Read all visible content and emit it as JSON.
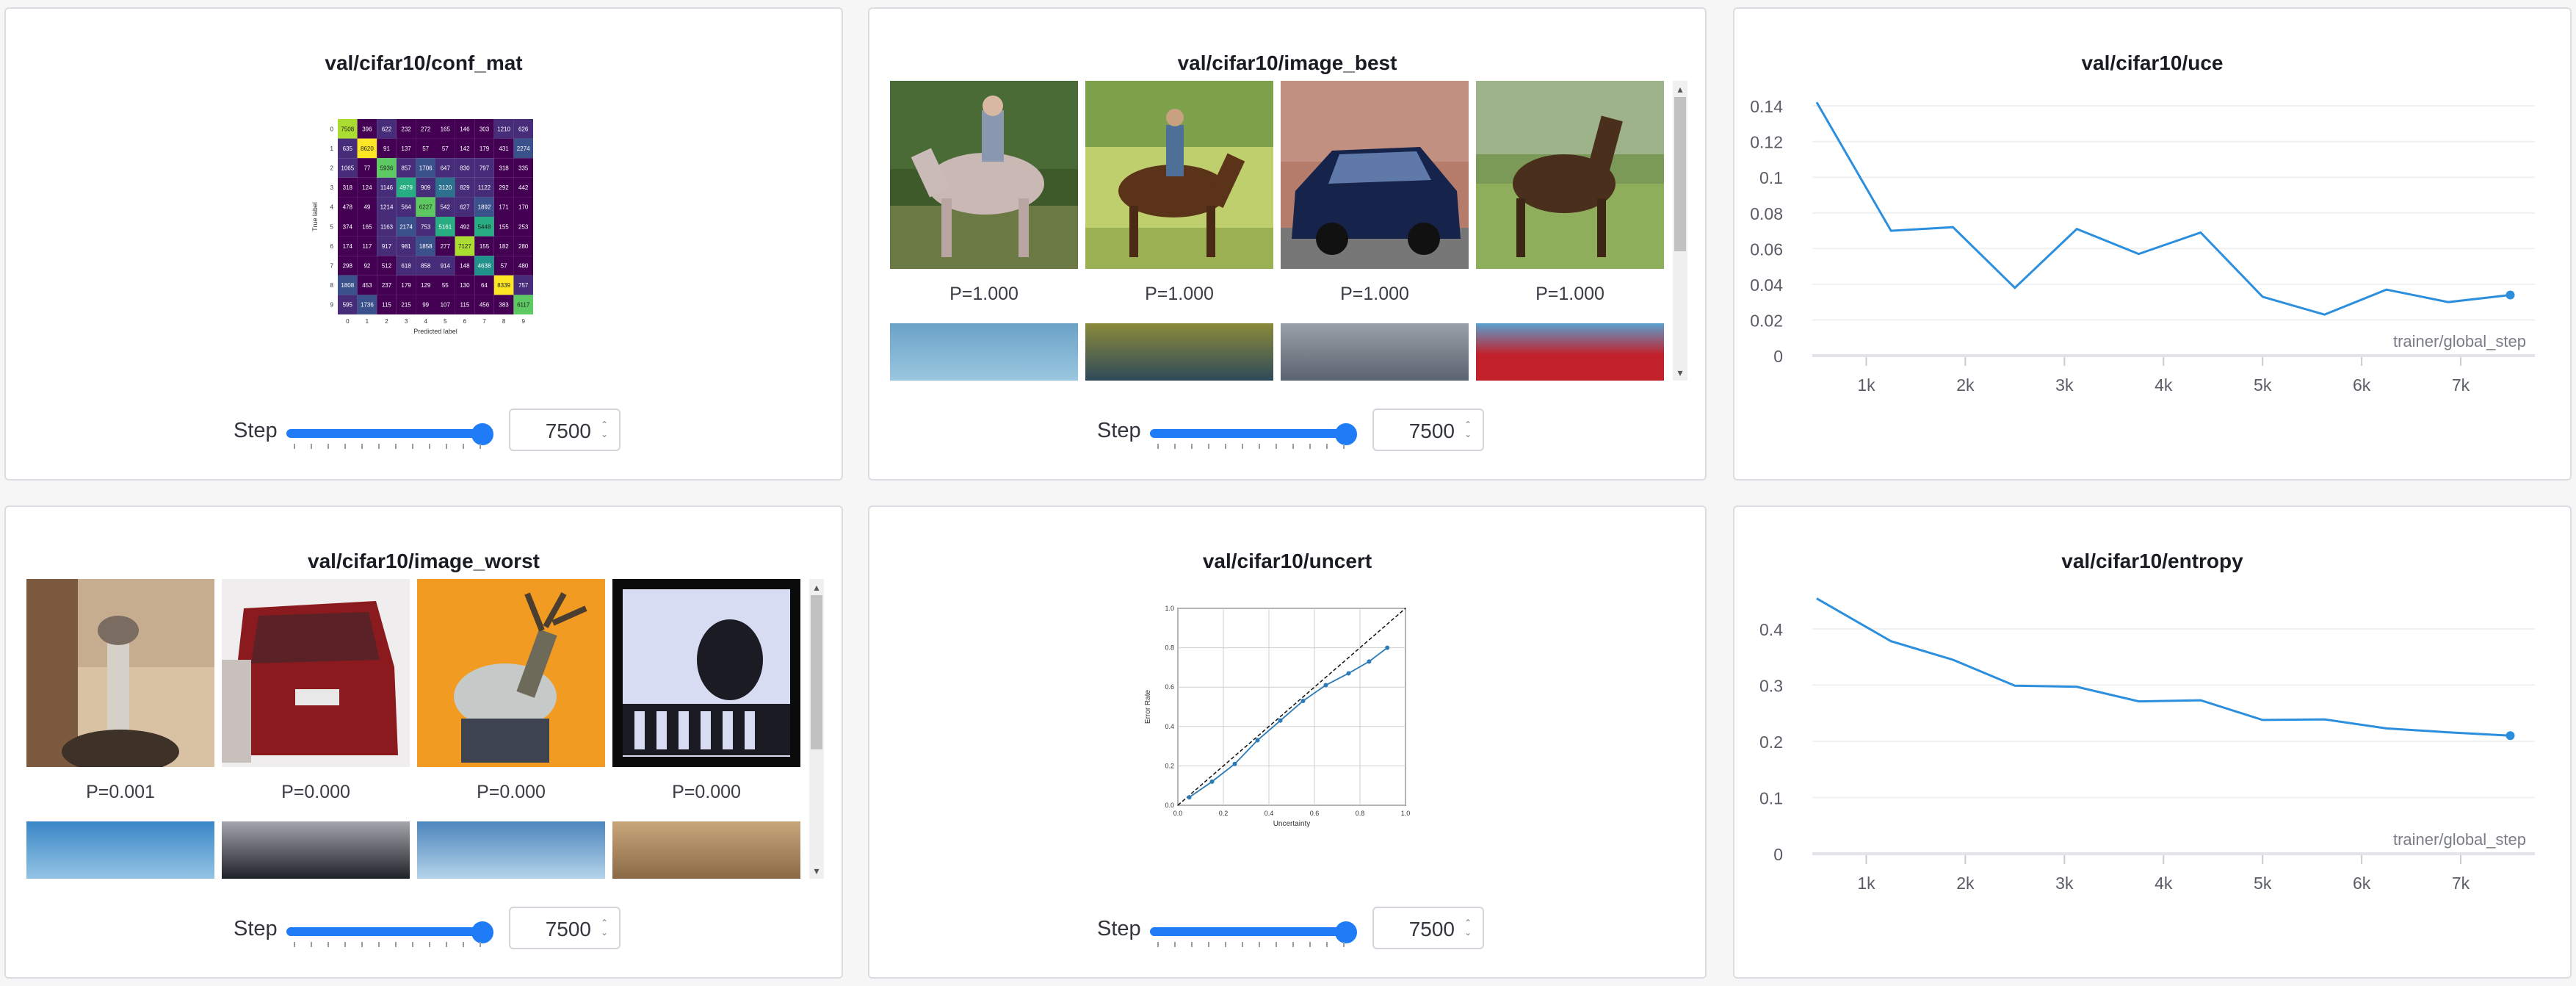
{
  "panels": {
    "conf_mat": {
      "title": "val/cifar10/conf_mat",
      "step_label": "Step",
      "step_value": "7500",
      "matrix_axes": {
        "x": "Predicted label",
        "y": "True label"
      },
      "matrix_ticks": [
        "0",
        "1",
        "2",
        "3",
        "4",
        "5",
        "6",
        "7",
        "8",
        "9"
      ],
      "matrix": [
        [
          "7508",
          "396",
          "622",
          "232",
          "272",
          "165",
          "146",
          "303",
          "1210",
          "626"
        ],
        [
          "635",
          "8620",
          "91",
          "137",
          "57",
          "57",
          "142",
          "179",
          "431",
          "2274"
        ],
        [
          "1065",
          "77",
          "5936",
          "857",
          "1706",
          "647",
          "830",
          "797",
          "318",
          "335"
        ],
        [
          "318",
          "124",
          "1146",
          "4979",
          "909",
          "3120",
          "829",
          "1122",
          "292",
          "442"
        ],
        [
          "478",
          "49",
          "1214",
          "564",
          "6227",
          "542",
          "627",
          "1892",
          "171",
          "170"
        ],
        [
          "374",
          "165",
          "1163",
          "2174",
          "753",
          "5161",
          "492",
          "5448",
          "155",
          "253"
        ],
        [
          "174",
          "117",
          "917",
          "981",
          "1858",
          "277",
          "7127",
          "155",
          "182",
          "280"
        ],
        [
          "298",
          "92",
          "512",
          "618",
          "858",
          "914",
          "148",
          "4638",
          "57",
          "480"
        ],
        [
          "1808",
          "453",
          "237",
          "179",
          "129",
          "55",
          "130",
          "64",
          "8339",
          "757"
        ],
        [
          "595",
          "1736",
          "115",
          "215",
          "99",
          "107",
          "115",
          "456",
          "383",
          "6117"
        ]
      ]
    },
    "image_best": {
      "title": "val/cifar10/image_best",
      "step_label": "Step",
      "step_value": "7500",
      "captions": [
        "P=1.000",
        "P=1.000",
        "P=1.000",
        "P=1.000"
      ]
    },
    "uce": {
      "title": "val/cifar10/uce",
      "xaxis_label": "trainer/global_step",
      "x_ticks": [
        "1k",
        "2k",
        "3k",
        "4k",
        "5k",
        "6k",
        "7k"
      ],
      "y_ticks": [
        "0",
        "0.02",
        "0.04",
        "0.06",
        "0.08",
        "0.1",
        "0.12",
        "0.14"
      ]
    },
    "image_worst": {
      "title": "val/cifar10/image_worst",
      "step_label": "Step",
      "step_value": "7500",
      "captions": [
        "P=0.001",
        "P=0.000",
        "P=0.000",
        "P=0.000"
      ]
    },
    "uncert": {
      "title": "val/cifar10/uncert",
      "step_label": "Step",
      "step_value": "7500",
      "xlabel": "Uncertainty",
      "ylabel": "Error Rate",
      "ticks": [
        "0.0",
        "0.2",
        "0.4",
        "0.6",
        "0.8",
        "1.0"
      ]
    },
    "entropy": {
      "title": "val/cifar10/entropy",
      "xaxis_label": "trainer/global_step",
      "x_ticks": [
        "1k",
        "2k",
        "3k",
        "4k",
        "5k",
        "6k",
        "7k"
      ],
      "y_ticks": [
        "0",
        "0.1",
        "0.2",
        "0.3",
        "0.4"
      ]
    }
  },
  "colors": {
    "accent": "#1f7cf6",
    "line": "#2c8fde",
    "panel_border": "#dcdde2"
  },
  "chart_data": [
    {
      "type": "line",
      "title": "val/cifar10/uce",
      "xlabel": "trainer/global_step",
      "x": [
        500,
        1250,
        1875,
        2500,
        3125,
        3750,
        4375,
        5000,
        5625,
        6250,
        6875,
        7500
      ],
      "y": [
        0.142,
        0.07,
        0.072,
        0.038,
        0.071,
        0.057,
        0.069,
        0.033,
        0.023,
        0.037,
        0.03,
        0.034
      ],
      "xlim": [
        500,
        7600
      ],
      "ylim": [
        0,
        0.145
      ]
    },
    {
      "type": "line",
      "title": "val/cifar10/entropy",
      "xlabel": "trainer/global_step",
      "x": [
        500,
        1250,
        1875,
        2500,
        3125,
        3750,
        4375,
        5000,
        5625,
        6250,
        6875,
        7500
      ],
      "y": [
        0.454,
        0.378,
        0.345,
        0.299,
        0.297,
        0.271,
        0.273,
        0.238,
        0.239,
        0.223,
        0.216,
        0.21
      ],
      "xlim": [
        500,
        7600
      ],
      "ylim": [
        0,
        0.46
      ]
    },
    {
      "type": "line",
      "title": "val/cifar10/uncert",
      "xlabel": "Uncertainty",
      "ylabel": "Error Rate",
      "x": [
        0.05,
        0.15,
        0.25,
        0.35,
        0.45,
        0.55,
        0.65,
        0.75,
        0.84,
        0.92
      ],
      "y": [
        0.04,
        0.12,
        0.21,
        0.33,
        0.43,
        0.53,
        0.61,
        0.67,
        0.73,
        0.8
      ],
      "xlim": [
        0,
        1
      ],
      "ylim": [
        0,
        1
      ],
      "reference_line": "diagonal"
    }
  ]
}
